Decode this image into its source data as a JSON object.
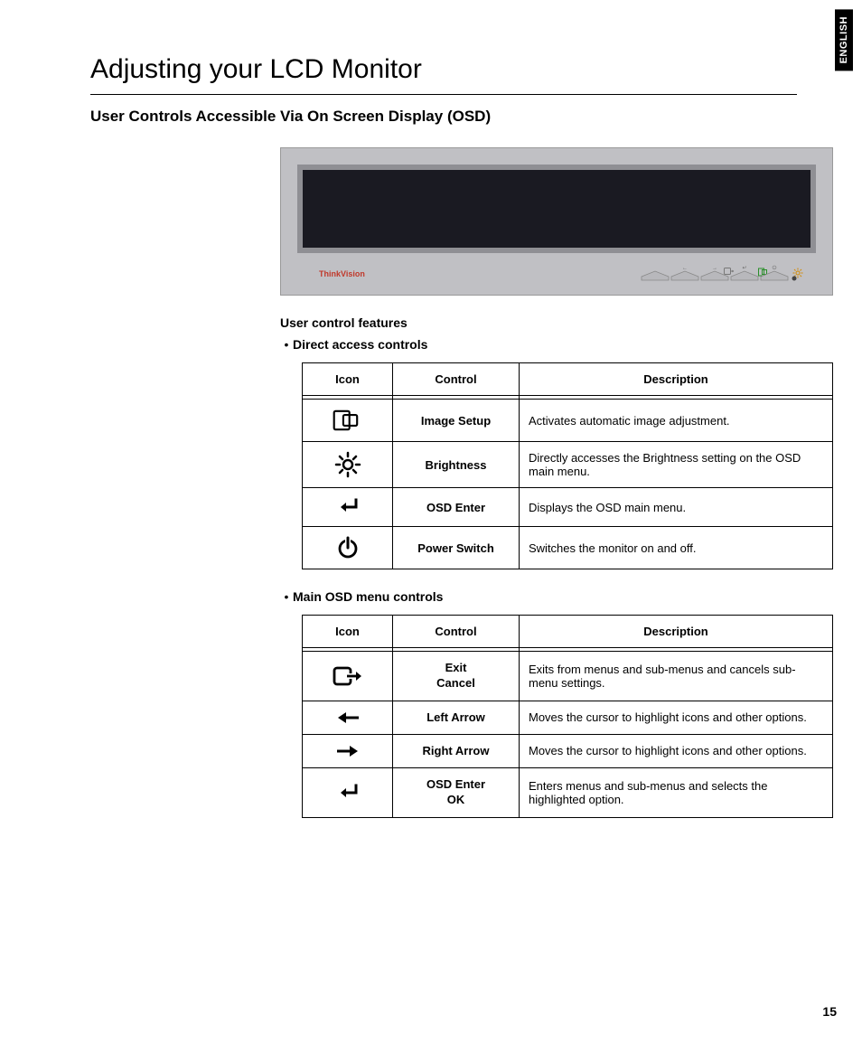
{
  "language_tab": "ENGLISH",
  "page_number": "15",
  "title": "Adjusting your LCD Monitor",
  "subtitle": "User Controls Accessible Via On Screen Display (OSD)",
  "monitor_brand": "ThinkVision",
  "section_heading": "User control features",
  "bullets": {
    "direct": "Direct access controls",
    "main": "Main OSD menu controls"
  },
  "table_headers": {
    "icon": "Icon",
    "control": "Control",
    "description": "Description"
  },
  "direct_rows": [
    {
      "icon": "image-setup",
      "control": "Image Setup",
      "description": "Activates automatic image adjustment."
    },
    {
      "icon": "brightness",
      "control": "Brightness",
      "description": "Directly accesses the Brightness setting on the OSD main menu."
    },
    {
      "icon": "enter",
      "control": "OSD Enter",
      "description": "Displays the OSD main menu."
    },
    {
      "icon": "power",
      "control": "Power Switch",
      "description": "Switches the monitor on and off."
    }
  ],
  "main_rows": [
    {
      "icon": "exit",
      "control": "Exit\nCancel",
      "description": "Exits from menus and sub-menus and cancels sub-menu settings."
    },
    {
      "icon": "left-arrow",
      "control": "Left Arrow",
      "description": "Moves the cursor to highlight icons and other options."
    },
    {
      "icon": "right-arrow",
      "control": "Right Arrow",
      "description": "Moves the cursor to highlight icons and other options."
    },
    {
      "icon": "enter",
      "control": "OSD Enter\nOK",
      "description": "Enters menus and sub-menus and selects the highlighted option."
    }
  ]
}
